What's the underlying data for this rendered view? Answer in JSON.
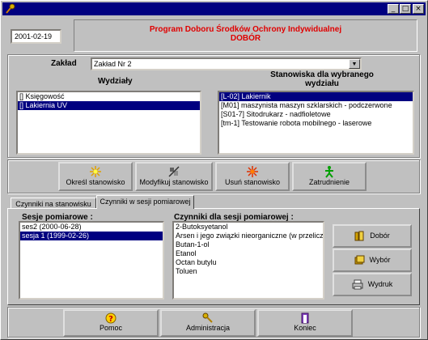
{
  "date_field": "2001-02-19",
  "header": {
    "line1": "Program Doboru Środków Ochrony Indywidualnej",
    "line2": "DOBÓR"
  },
  "zaklad": {
    "label": "Zakład",
    "value": "Zakład Nr 2"
  },
  "wydzialy": {
    "label": "Wydziały",
    "items": [
      "[] Księgowość",
      "[] Lakiernia UV"
    ],
    "selected": 1
  },
  "stanowiska": {
    "label_line1": "Stanowiska dla wybranego",
    "label_line2": "wydziału",
    "items": [
      "[L-02] Lakiernik",
      "[M01] maszynista maszyn szklarskich - podczerwone",
      "[S01-7] Sitodrukarz - nadfioletowe",
      "[tm-1] Testowanie robota mobilnego - laserowe"
    ],
    "selected": 0
  },
  "actions": {
    "okresl": "Określ stanowisko",
    "modyfikuj": "Modyfikuj stanowisko",
    "usun": "Usuń stanowisko",
    "zatrudnienie": "Zatrudnienie"
  },
  "tabs": {
    "tab1": "Czynniki na stanowisku",
    "tab2": "Czynniki w sesji pomiarowej"
  },
  "sesje": {
    "label": "Sesje pomiarowe :",
    "items": [
      "ses2 (2000-06-28)",
      "sesja 1 (1999-02-26)"
    ],
    "selected": 1
  },
  "czynniki": {
    "label": "Czynniki dla sesji pomiarowej :",
    "items": [
      "2-Butoksyetanol",
      "Arsen i jego związki nieorganiczne (w przelicz",
      "Butan-1-ol",
      "Etanol",
      "Octan butylu",
      "Toluen"
    ]
  },
  "side_buttons": {
    "dobor": "Dobór",
    "wybor": "Wybór",
    "wydruk": "Wydruk"
  },
  "bottom": {
    "pomoc": "Pomoc",
    "administracja": "Administracja",
    "koniec": "Koniec"
  },
  "colors": {
    "title_bar": "#000080",
    "header_text": "#e00000",
    "selection": "#000080"
  }
}
